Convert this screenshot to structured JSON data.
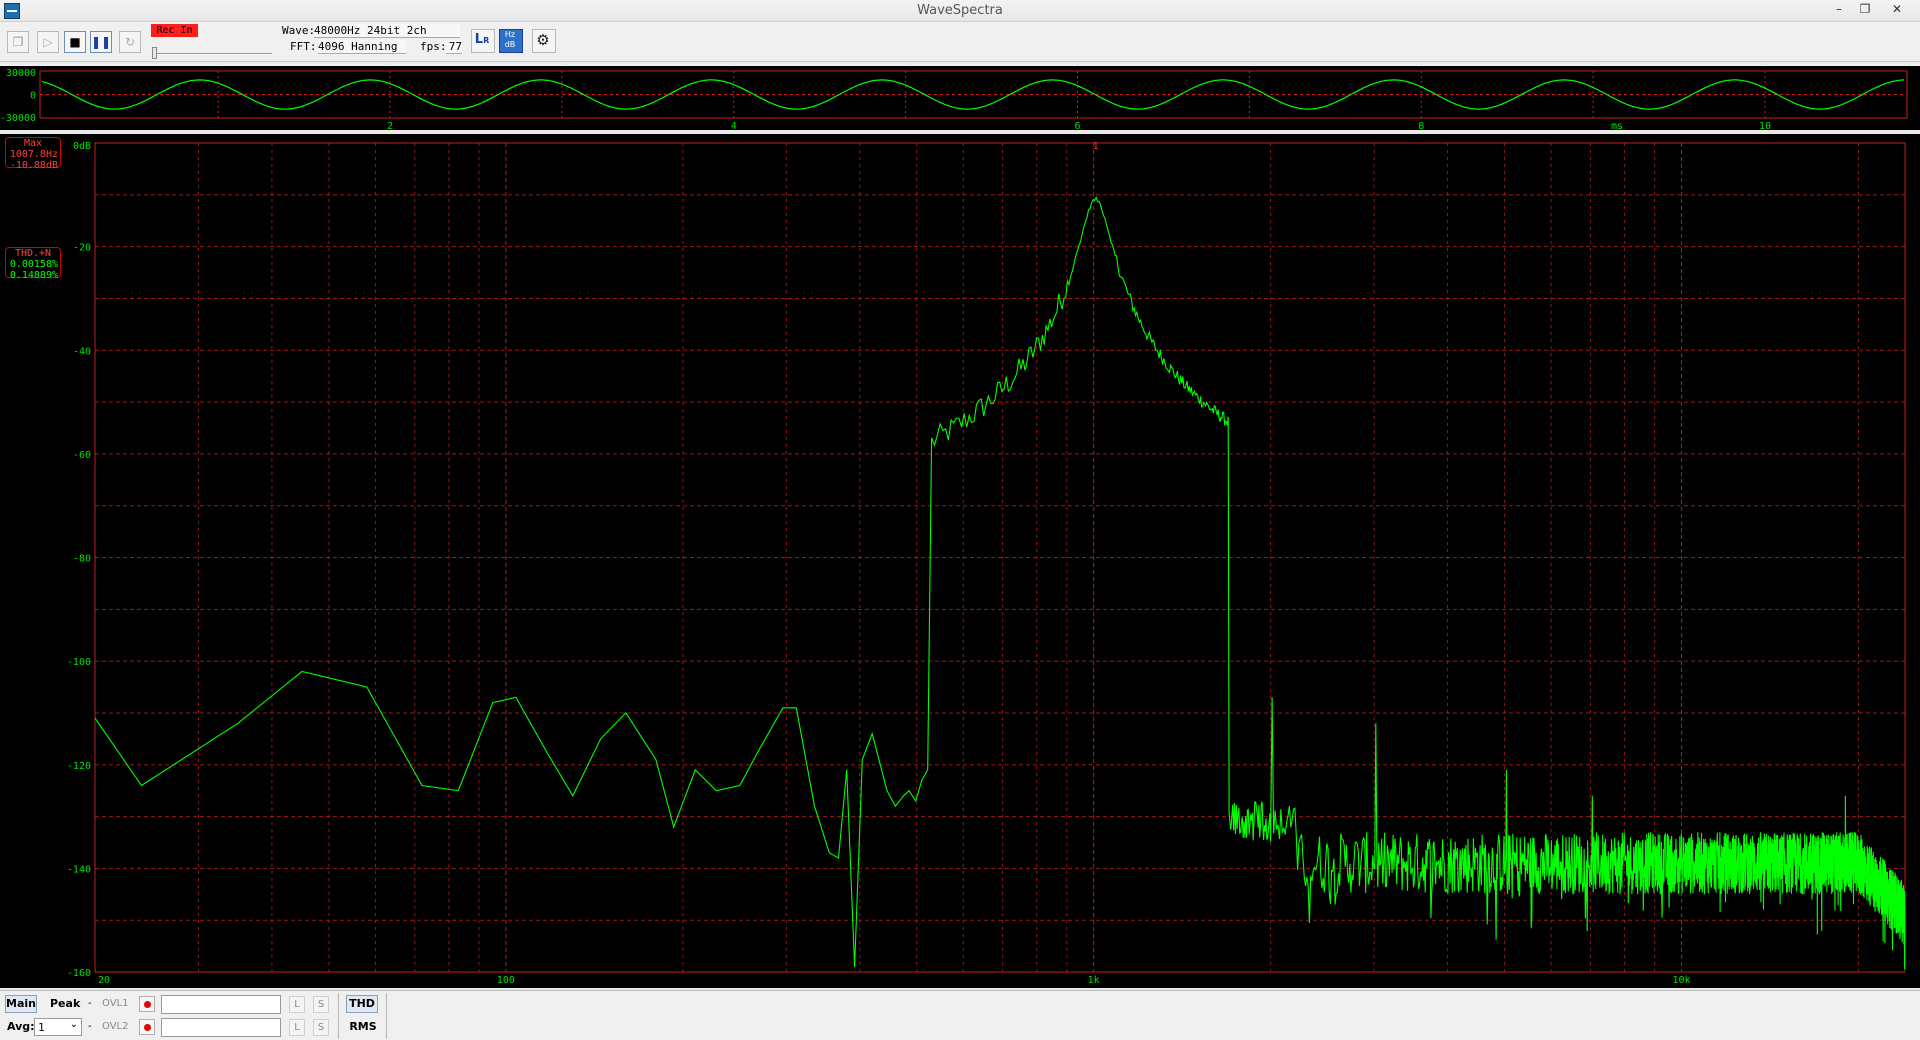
{
  "window": {
    "title": "WaveSpectra"
  },
  "toolbar": {
    "rec_in": "Rec In",
    "wave_label": "Wave:",
    "wave_value": "48000Hz 24bit 2ch",
    "fft_label": "FFT:",
    "fft_value": "4096 Hanning",
    "fps_label": "fps:",
    "fps_value": "77",
    "level_fraction": 0.0
  },
  "waveform": {
    "y_ticks": [
      "30000",
      "0",
      "-30000"
    ],
    "x_ticks": [
      "2",
      "4",
      "6",
      "8",
      "10"
    ],
    "unit": "ms"
  },
  "spectrum": {
    "y_ticks": [
      "0dB",
      "-20",
      "-40",
      "-60",
      "-80",
      "-100",
      "-120",
      "-140",
      "-160"
    ],
    "x_ticks": [
      "20",
      "100",
      "1k",
      "10k"
    ],
    "peak_marker": "1",
    "max_box": {
      "title": "Max",
      "freq": "1007.8Hz",
      "level": "-10.88dB"
    },
    "thd_box": {
      "title": "THD.+N",
      "thd": "0.00158%",
      "thdn": "0.14889%"
    }
  },
  "bottombar": {
    "main": "Main",
    "peak": "Peak",
    "dash": "-",
    "ovl1": "OVL1",
    "ovl2": "OVL2",
    "l": "L",
    "s": "S",
    "avg_label": "Avg:",
    "avg_value": "1",
    "thd": "THD",
    "rms": "RMS"
  },
  "colors": {
    "trace": "#00ff00",
    "grid": "#c81e1e",
    "axis_text": "#00e000",
    "marker": "#ff3030"
  }
}
